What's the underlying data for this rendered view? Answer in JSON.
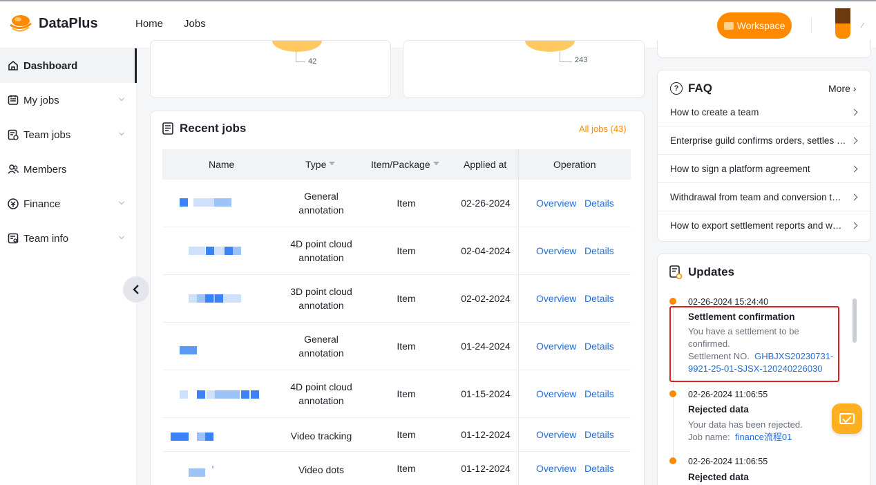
{
  "header": {
    "logo_text": "DataPlus",
    "nav": [
      "Home",
      "Jobs"
    ],
    "workspace_label": "Workspace"
  },
  "sidebar": {
    "items": [
      {
        "label": "Dashboard",
        "icon": "home-icon",
        "active": true,
        "expandable": false
      },
      {
        "label": "My jobs",
        "icon": "jobs-icon",
        "active": false,
        "expandable": true
      },
      {
        "label": "Team jobs",
        "icon": "team-jobs-icon",
        "active": false,
        "expandable": true
      },
      {
        "label": "Members",
        "icon": "members-icon",
        "active": false,
        "expandable": false
      },
      {
        "label": "Finance",
        "icon": "finance-icon",
        "active": false,
        "expandable": true
      },
      {
        "label": "Team info",
        "icon": "team-info-icon",
        "active": false,
        "expandable": true
      }
    ]
  },
  "pies": [
    {
      "value_label": "42"
    },
    {
      "value_label": "243"
    }
  ],
  "recent_jobs": {
    "title": "Recent jobs",
    "all_jobs_label": "All jobs (43)",
    "columns": [
      "Name",
      "Type",
      "Item/Package",
      "Applied at",
      "Operation"
    ],
    "rows": [
      {
        "type_line1": "General",
        "type_line2": "annotation",
        "item": "Item",
        "applied": "02-26-2024"
      },
      {
        "type_line1": "4D point cloud",
        "type_line2": "annotation",
        "item": "Item",
        "applied": "02-04-2024"
      },
      {
        "type_line1": "3D point cloud",
        "type_line2": "annotation",
        "item": "Item",
        "applied": "02-02-2024"
      },
      {
        "type_line1": "General",
        "type_line2": "annotation",
        "item": "Item",
        "applied": "01-24-2024"
      },
      {
        "type_line1": "4D point cloud",
        "type_line2": "annotation",
        "item": "Item",
        "applied": "01-15-2024"
      },
      {
        "type_line1": "Video tracking",
        "type_line2": "",
        "item": "Item",
        "applied": "01-12-2024"
      },
      {
        "type_line1": "Video dots",
        "type_line2": "",
        "item": "Item",
        "applied": "01-12-2024"
      }
    ],
    "overview_label": "Overview",
    "details_label": "Details"
  },
  "faq": {
    "title": "FAQ",
    "more_label": "More",
    "items": [
      "How to create a team",
      "Enterprise guild confirms orders, settles …",
      "How to sign a platform agreement",
      "Withdrawal from team and conversion t…",
      "How to export settlement reports and w…"
    ]
  },
  "updates": {
    "title": "Updates",
    "entries": [
      {
        "time": "02-26-2024 15:24:40",
        "heading": "Settlement confirmation",
        "line1": "You have a settlement to be",
        "line2": "confirmed.",
        "line3_prefix": "Settlement NO.",
        "link_a": "GHBJXS20230731-",
        "link_b": "9921-25-01-SJSX-120240226030"
      },
      {
        "time": "02-26-2024 11:06:55",
        "heading": "Rejected data",
        "line1": "Your data has been rejected.",
        "line2_prefix": "Job name:",
        "link": "finance流程01"
      },
      {
        "time": "02-26-2024 11:06:55",
        "heading": "Rejected data"
      }
    ]
  }
}
